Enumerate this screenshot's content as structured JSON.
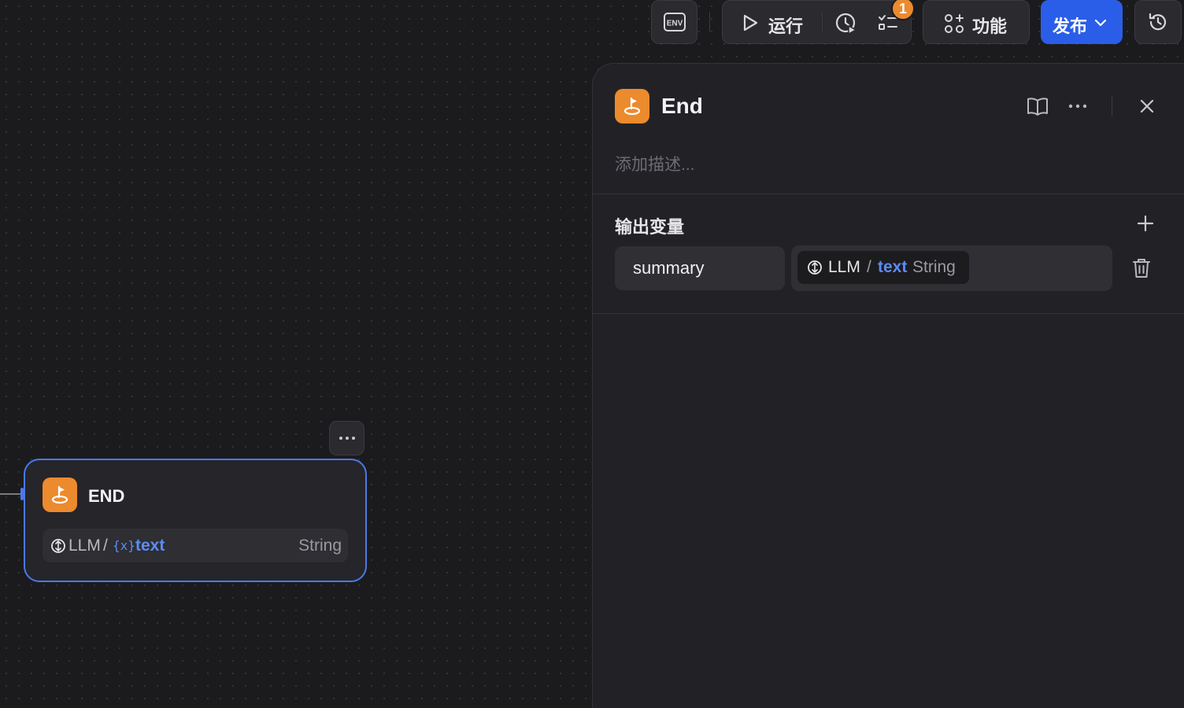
{
  "toolbar": {
    "env_label": "ENV",
    "run_label": "运行",
    "checklist_badge": "1",
    "features_label": "功能",
    "publish_label": "发布"
  },
  "panel": {
    "title": "End",
    "description_placeholder": "添加描述...",
    "section_title": "输出变量",
    "outputs": [
      {
        "name": "summary",
        "source_node": "LLM",
        "separator": "/",
        "variable": "text",
        "type": "String"
      }
    ]
  },
  "canvas_node": {
    "title": "END",
    "var_source": "LLM",
    "var_separator": "/",
    "var_symbol": "{x}",
    "var_name": "text",
    "var_type": "String"
  },
  "colors": {
    "accent_blue": "#2a5ee8",
    "node_orange": "#ec8a2e",
    "variable_blue": "#5b8cf5",
    "selected_border": "#4b79e8"
  }
}
